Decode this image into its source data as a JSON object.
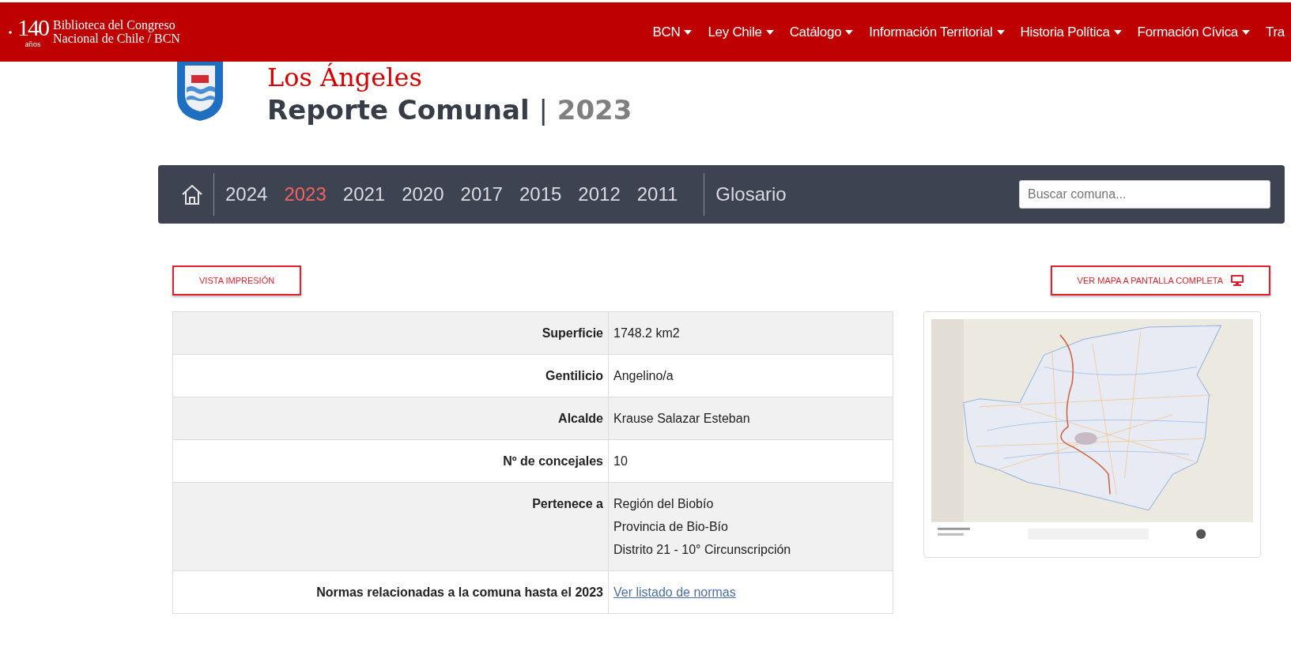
{
  "header": {
    "logo_number": "140",
    "logo_sub": "años",
    "logo_line1": "Biblioteca del Congreso",
    "logo_line2": "Nacional de Chile / BCN",
    "menu": [
      {
        "label": "BCN"
      },
      {
        "label": "Ley Chile"
      },
      {
        "label": "Catálogo"
      },
      {
        "label": "Información Territorial"
      },
      {
        "label": "Historia Política"
      },
      {
        "label": "Formación Cívica"
      },
      {
        "label": "Tra"
      }
    ]
  },
  "title": {
    "commune": "Los Ángeles",
    "report": "Reporte Comunal",
    "separator": "|",
    "year": "2023"
  },
  "year_nav": {
    "years": [
      {
        "label": "2024",
        "selected": false
      },
      {
        "label": "2023",
        "selected": true
      },
      {
        "label": "2021",
        "selected": false
      },
      {
        "label": "2020",
        "selected": false
      },
      {
        "label": "2017",
        "selected": false
      },
      {
        "label": "2015",
        "selected": false
      },
      {
        "label": "2012",
        "selected": false
      },
      {
        "label": "2011",
        "selected": false
      }
    ],
    "glossary": "Glosario",
    "search": {
      "placeholder": "Buscar comuna..."
    }
  },
  "print_button": "VISTA IMPRESIÓN",
  "map_button": "VER MAPA A PANTALLA COMPLETA",
  "info_table": [
    {
      "label": "Superficie",
      "values": [
        "1748.2 km2"
      ],
      "kind": "text"
    },
    {
      "label": "Gentilicio",
      "values": [
        "Angelino/a"
      ],
      "kind": "text"
    },
    {
      "label": "Alcalde",
      "values": [
        "Krause Salazar Esteban"
      ],
      "kind": "text"
    },
    {
      "label": "Nº de concejales",
      "values": [
        "10"
      ],
      "kind": "text"
    },
    {
      "label": "Pertenece a",
      "values": [
        "Región del Biobío",
        "Provincia de Bio-Bío",
        "Distrito 21 - 10° Circunscripción"
      ],
      "kind": "text"
    },
    {
      "label": "Normas relacionadas a la comuna hasta el 2023",
      "values": [
        "Ver listado de normas"
      ],
      "kind": "link"
    }
  ]
}
